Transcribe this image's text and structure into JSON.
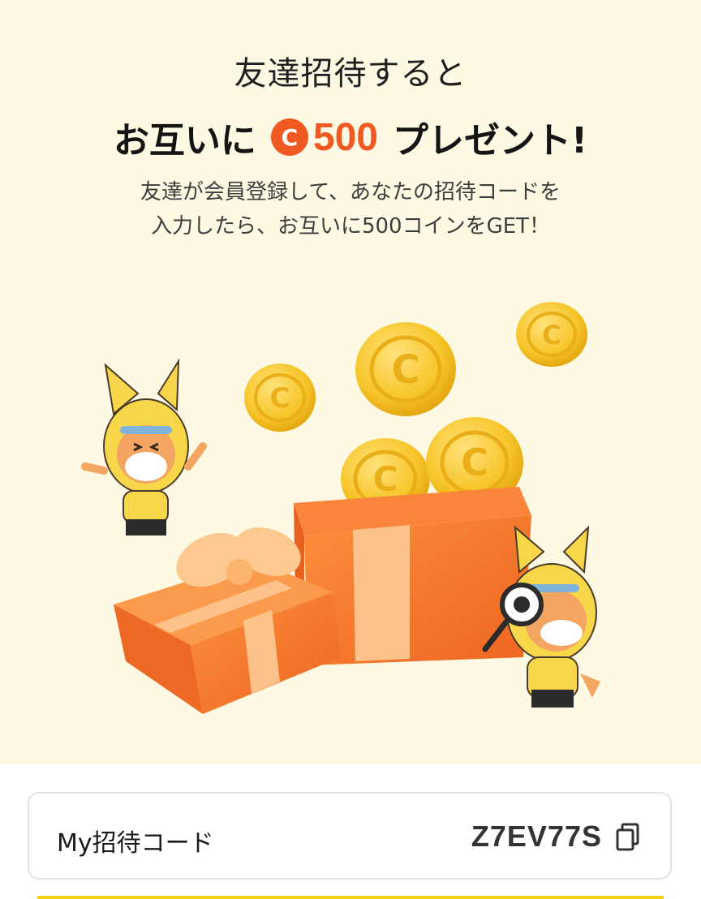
{
  "hero": {
    "headline_line1": "友達招待すると",
    "headline_prefix": "お互いに",
    "coin_symbol": "C",
    "reward_amount": "500",
    "headline_suffix": "プレゼント!",
    "description_line1": "友達が会員登録して、あなたの招待コードを",
    "description_line2": "入力したら、お互いに500コインをGET！"
  },
  "invite_code": {
    "label": "My招待コード",
    "value": "Z7EV77S",
    "copy_icon": "copy-icon"
  },
  "colors": {
    "hero_background": "#fef9e3",
    "accent_orange": "#f05a22",
    "coin_gold": "#f7c52a",
    "gift_orange": "#f47a2b",
    "ribbon_peach": "#fcc28a",
    "bottom_bar_yellow": "#f5d21a"
  }
}
